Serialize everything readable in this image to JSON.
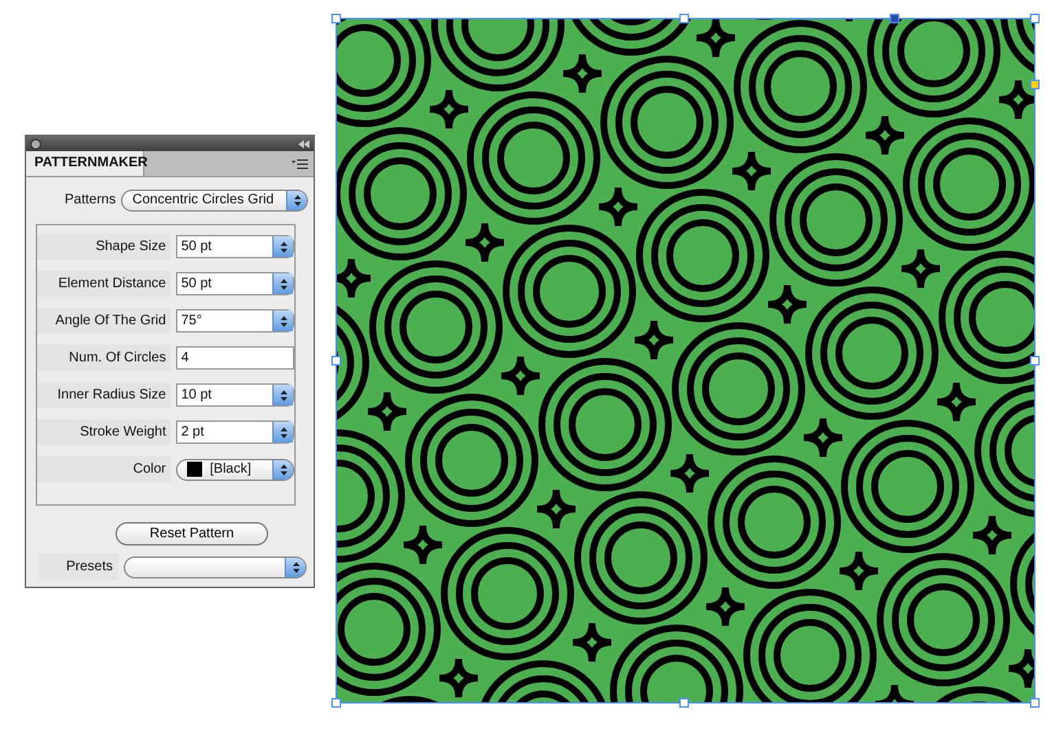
{
  "panel": {
    "tab": {
      "label": "PATTERNMAKER",
      "selected": true
    },
    "patterns": {
      "label": "Patterns",
      "value": "Concentric Circles Grid"
    },
    "fields": [
      {
        "kind": "stepper",
        "label": "Shape Size",
        "value": "50 pt"
      },
      {
        "kind": "stepper",
        "label": "Element Distance",
        "value": "50 pt"
      },
      {
        "kind": "stepper",
        "label": "Angle Of The Grid",
        "value": "75°"
      },
      {
        "kind": "text",
        "label": "Num. Of Circles",
        "value": "4"
      },
      {
        "kind": "stepper",
        "label": "Inner Radius Size",
        "value": "10 pt"
      },
      {
        "kind": "stepper",
        "label": "Stroke Weight",
        "value": "2 pt"
      },
      {
        "kind": "color",
        "label": "Color",
        "value": "[Black]",
        "color": "#000000"
      }
    ],
    "reset_button": "Reset Pattern",
    "presets": {
      "label": "Presets"
    }
  }
}
